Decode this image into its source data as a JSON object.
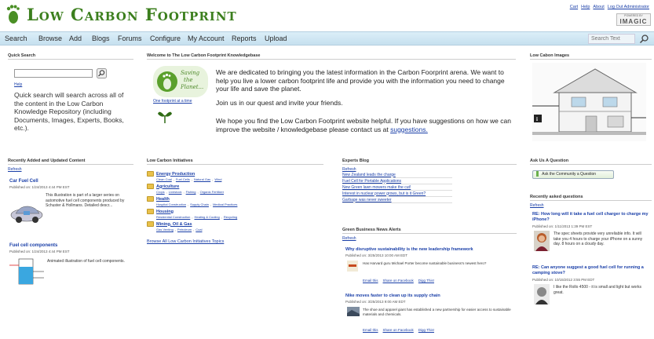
{
  "header": {
    "logo_text": "Low Carbon Footprint",
    "top_links": [
      "Cart",
      "Help",
      "About",
      "Log Out Administrator"
    ],
    "powered_by": "POWERED BY",
    "powered_name": "IMAGIC"
  },
  "nav": {
    "items": [
      "Search",
      "Browse",
      "Add",
      "Blogs",
      "Forums",
      "Configure",
      "My Account",
      "Reports",
      "Upload"
    ],
    "search_placeholder": "Search Text"
  },
  "quick_search": {
    "title": "Quick Search",
    "help": "Help",
    "description": "Quick search will search across all of the content in the Low Carbon Knowledge Repository (including Documents, Images, Experts, Books, etc.)."
  },
  "welcome": {
    "title": "Welcome to The Low Carbon Footprint Knowledgebase",
    "saving_line1": "Saving",
    "saving_line2": "the",
    "saving_line3": "Planet...",
    "one_footprint": "One footprint at a time",
    "para1": "We are dedicated to bringing you the latest information in the Carbon Foorprint arena. We want to help you live a lower carbon footprint life and provide you with the information you need to change your life and save the planet.",
    "para2": "Join us in our quest and invite your friends.",
    "para3": "We hope you find the Low Carbon Footprint website helpful.  If you have suggestions on how we can improve the website / knowledgebase please contact us at",
    "suggestions_link": "suggestions."
  },
  "images_box": {
    "title": "Low Cabon Images"
  },
  "recent": {
    "title": "Recently Added and Updated Content",
    "refresh": "Refresh",
    "items": [
      {
        "title": "Car Fuel Cell",
        "date": "Published on: 1/24/2013 4:44 PM EST",
        "desc": "This illustration is part of a larger series on automotive fuel cell components produced by Schuster & Hollmans. Detailed descr..."
      },
      {
        "title": "Fuel cell components",
        "date": "Published on: 1/24/2013 4:44 PM EST",
        "desc": "Animated illustration of fuel cell components."
      }
    ]
  },
  "initiatives": {
    "title": "Low Carbon Initiatives",
    "categories": [
      {
        "name": "Energy Production",
        "subs": [
          "Clean Coal",
          "Fuel Cells",
          "Natural Gas",
          "Wind"
        ]
      },
      {
        "name": "Agriculture",
        "subs": [
          "Crops",
          "Livestock",
          "Fishing",
          "Organic Fertilizer"
        ]
      },
      {
        "name": "Health",
        "subs": [
          "Hospital Construction",
          "Supply Chain",
          "Medical Practices"
        ]
      },
      {
        "name": "Housing",
        "subs": [
          "Residential Construction",
          "Heating & Cooling",
          "Recycling"
        ]
      },
      {
        "name": "Mining, Oil & Gas",
        "subs": [
          "Gas Venting",
          "Petroleum",
          "Coal"
        ]
      }
    ],
    "browse_all": "Browse All Low Carbon Initiatives Topics"
  },
  "experts_blog": {
    "title": "Experts Blog",
    "refresh": "Refresh",
    "posts": [
      "New Zealand leads the charge",
      "Fuel Cell for Portable Applications",
      "New Green lawn mowers make the cut!",
      "Interest in nuclear power grows, but is it Green?",
      "Garbage was never sweeter"
    ]
  },
  "news": {
    "title": "Green Business News Alerts",
    "refresh": "Refresh",
    "items": [
      {
        "headline": "Why disruptive sustainability is the new leadership framework",
        "date": "Published on: 3/25/2013 10:00 AM EDT",
        "summary": "Has Harvard guru Michael Porter become sustainable business's newest hero?"
      },
      {
        "headline": "Nike moves faster to clean up its supply chain",
        "date": "Published on: 3/25/2013 9:00 AM EDT",
        "summary": "The shoe and apparel giant has established a new partnership for easier access to sustainable materials and chemicals."
      }
    ],
    "actions": [
      "Email this",
      "Share on Facebook",
      "Digg This!"
    ]
  },
  "ask": {
    "title": "Ask Us A Question",
    "button": "Ask the Community a Question",
    "recent_title": "Recently asked questions",
    "refresh": "Refresh",
    "questions": [
      {
        "title": "RE: How long will it take a fuel cell charger to charge my iPhone?",
        "date": "Published on: 1/11/2013 1:39 PM EST",
        "body": "The spec sheets provide very unreliable info.  It will take you 4 hours to charge your iPhone on a sunny day. 8 hours on a cloudy day."
      },
      {
        "title": "RE: Can anyone suggest a good fuel cell for running a camping stove?",
        "date": "Published on: 10/15/2012 3:55 PM EDT",
        "body": "I like the Rollo 4500 - it is small and light but works great."
      }
    ]
  },
  "colors": {
    "brand_green": "#3c7f1e",
    "nav_bg": "#cfe6f3",
    "link": "#1a3fa8"
  }
}
